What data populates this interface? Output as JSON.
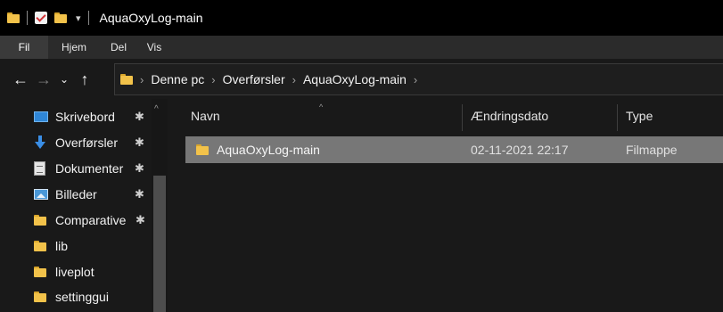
{
  "window": {
    "title": "AquaOxyLog-main",
    "quick_access_dropdown": "▾"
  },
  "ribbon": {
    "tabs": [
      {
        "label": "Fil",
        "active": true
      },
      {
        "label": "Hjem"
      },
      {
        "label": "Del"
      },
      {
        "label": "Vis"
      }
    ]
  },
  "navigation": {
    "back": "←",
    "forward": "→",
    "recent": "⌄",
    "up": "↑",
    "breadcrumb": [
      "Denne pc",
      "Overførsler",
      "AquaOxyLog-main"
    ],
    "separator": "›"
  },
  "sidebar": {
    "pin_glyph": "✱",
    "items": [
      {
        "label": "Skrivebord",
        "icon": "desktop-icon",
        "pinned": true
      },
      {
        "label": "Overførsler",
        "icon": "download-icon",
        "pinned": true
      },
      {
        "label": "Dokumenter",
        "icon": "documents-icon",
        "pinned": true
      },
      {
        "label": "Billeder",
        "icon": "pictures-icon",
        "pinned": true
      },
      {
        "label": "Comparative",
        "icon": "folder-icon",
        "pinned": true
      },
      {
        "label": "lib",
        "icon": "folder-icon",
        "pinned": false
      },
      {
        "label": "liveplot",
        "icon": "folder-icon",
        "pinned": false
      },
      {
        "label": "settinggui",
        "icon": "folder-icon",
        "pinned": false
      }
    ]
  },
  "file_list": {
    "columns": [
      "Navn",
      "Ændringsdato",
      "Type"
    ],
    "rows": [
      {
        "name": "AquaOxyLog-main",
        "modified": "02-11-2021 22:17",
        "type": "Filmappe",
        "selected": true
      }
    ]
  },
  "colors": {
    "folder": "#f2c24a",
    "selection": "#777777",
    "background": "#191919"
  }
}
